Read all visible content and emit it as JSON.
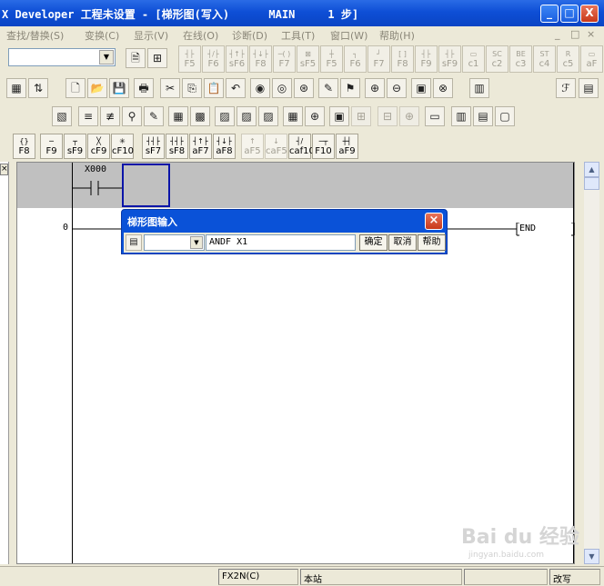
{
  "window": {
    "title": "X Developer 工程未设置 - [梯形图(写入)      MAIN     1 步]",
    "minimize": "_",
    "maximize": "□",
    "close": "X"
  },
  "menu": {
    "items": [
      "查找/替换(S)",
      "变换(C)",
      "显示(V)",
      "在线(O)",
      "诊断(D)",
      "工具(T)",
      "窗口(W)",
      "帮助(H)"
    ],
    "right": [
      "_",
      "□",
      "×"
    ]
  },
  "fkeys_row1": [
    {
      "sym": "┤├",
      "key": "F5"
    },
    {
      "sym": "┤/├",
      "key": "F6"
    },
    {
      "sym": "┤↑├",
      "key": "sF6"
    },
    {
      "sym": "┤↓├",
      "key": "F8"
    },
    {
      "sym": "─( )",
      "key": "F7"
    },
    {
      "sym": "⊠",
      "key": "sF5"
    },
    {
      "sym": "┼",
      "key": "F5"
    },
    {
      "sym": "┐",
      "key": "F6"
    },
    {
      "sym": "┘",
      "key": "F7"
    },
    {
      "sym": "[ ]",
      "key": "F8"
    },
    {
      "sym": "┤├",
      "key": "F9"
    },
    {
      "sym": "┤├",
      "key": "sF9"
    },
    {
      "sym": "▭",
      "key": "c1"
    },
    {
      "sym": "SC",
      "key": "c2"
    },
    {
      "sym": "BE",
      "key": "c3"
    },
    {
      "sym": "ST",
      "key": "c4"
    },
    {
      "sym": "R",
      "key": "c5"
    },
    {
      "sym": "▭",
      "key": "aF"
    }
  ],
  "toolbar2": [
    "▦",
    "⇅",
    "🗋",
    "📂",
    "💾",
    "🖶",
    "✂",
    "⎘",
    "📋",
    "↶",
    "◉",
    "◎",
    "⊛",
    "✎",
    "⚑",
    "⊕",
    "⊖",
    "▣",
    "⊗",
    "▥",
    "ℱ",
    "▤"
  ],
  "toolbar3": [
    "▧",
    "≡",
    "≢",
    "⚲",
    "✎",
    "▦",
    "▩",
    "▨",
    "▨",
    "▨",
    "▦",
    "⊕",
    "▣",
    "⊞",
    "⊟",
    "⊕",
    "▭",
    "▥",
    "▤",
    "▢"
  ],
  "ladder_keys": [
    {
      "sym": "{}",
      "key": "F8"
    },
    {
      "sym": "─",
      "key": "F9"
    },
    {
      "sym": "┬",
      "key": "sF9"
    },
    {
      "sym": "╳",
      "key": "cF9"
    },
    {
      "sym": "✳",
      "key": "cF10"
    },
    {
      "sym": "┤┤├",
      "key": "sF7"
    },
    {
      "sym": "┤┤├",
      "key": "sF8"
    },
    {
      "sym": "┤↑├",
      "key": "aF7"
    },
    {
      "sym": "┤↓├",
      "key": "aF8"
    },
    {
      "sym": "↑",
      "key": "aF5"
    },
    {
      "sym": "↓",
      "key": "caF5"
    },
    {
      "sym": "┤/",
      "key": "caf10"
    },
    {
      "sym": "─┬",
      "key": "F10"
    },
    {
      "sym": "┼┤",
      "key": "aF9"
    }
  ],
  "ladder": {
    "contact_label": "X000",
    "step_number": "0",
    "end_label": "END"
  },
  "dialog": {
    "title": "梯形图输入",
    "input_value": "ANDF X1",
    "ok": "确定",
    "cancel": "取消",
    "help": "帮助"
  },
  "status": {
    "cpu": "FX2N(C)",
    "station": "本站",
    "mode": "改写"
  },
  "watermark": {
    "brand": "Bai du 经验",
    "url": "jingyan.baidu.com"
  }
}
